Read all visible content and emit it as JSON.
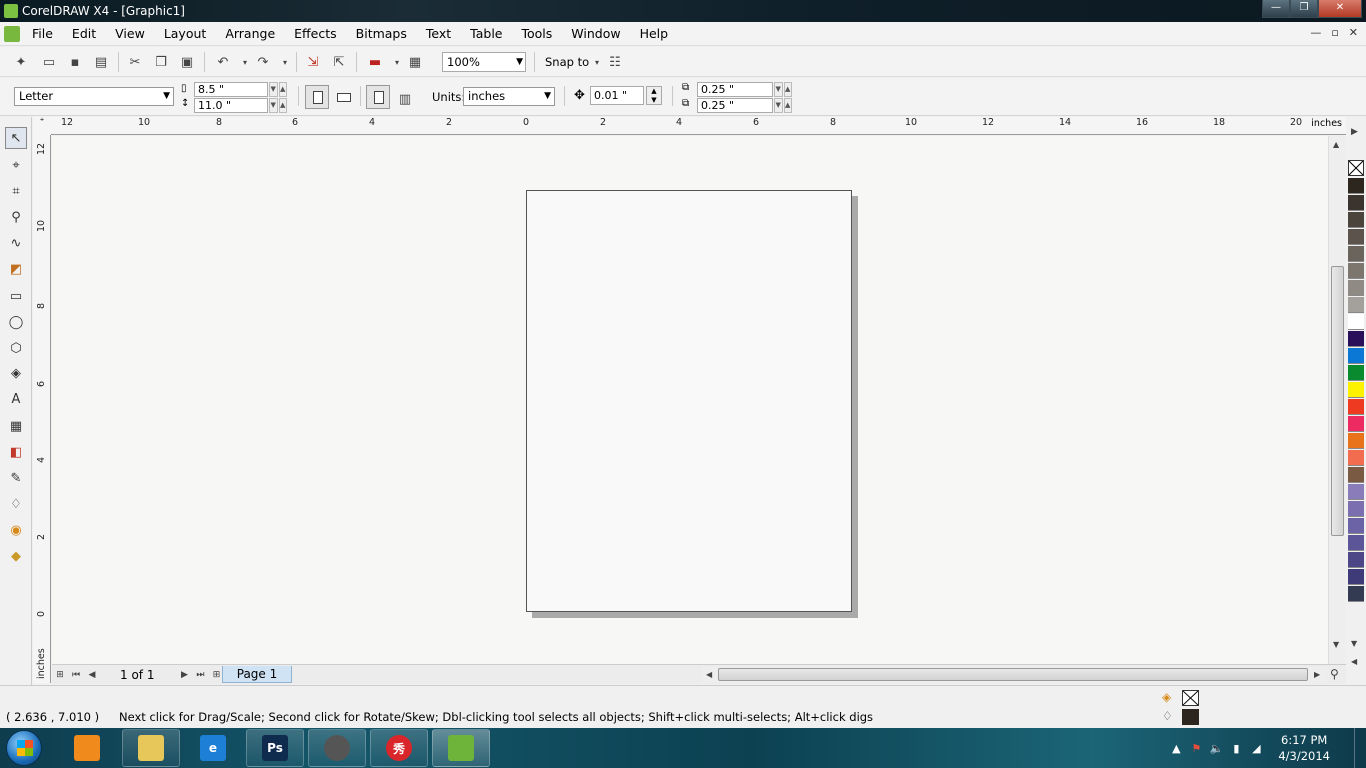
{
  "window": {
    "title": "CorelDRAW X4 - [Graphic1]",
    "controls": {
      "minimize": "—",
      "maximize": "❐",
      "close": "✕"
    }
  },
  "menu": {
    "items": [
      "File",
      "Edit",
      "View",
      "Layout",
      "Arrange",
      "Effects",
      "Bitmaps",
      "Text",
      "Table",
      "Tools",
      "Window",
      "Help"
    ],
    "mdi_controls": [
      "—",
      "▫",
      "✕"
    ]
  },
  "standard_toolbar": {
    "zoom_level": "100%",
    "snap_to_label": "Snap to"
  },
  "property_bar": {
    "paper_type": "Letter",
    "page_width": "8.5 \"",
    "page_height": "11.0 \"",
    "units_label": "Units:",
    "units_value": "inches",
    "nudge_distance": "0.01 \"",
    "duplicate_x": "0.25 \"",
    "duplicate_y": "0.25 \""
  },
  "ruler": {
    "units": "inches",
    "h_ticks": [
      "12",
      "10",
      "8",
      "6",
      "4",
      "2",
      "0",
      "2",
      "4",
      "6",
      "8",
      "10",
      "12",
      "14",
      "16",
      "18",
      "20"
    ],
    "v_ticks": [
      "12",
      "10",
      "8",
      "6",
      "4",
      "2",
      "0"
    ],
    "v_units": "inches"
  },
  "page_navigator": {
    "count": "1 of 1",
    "tab_label": "Page 1"
  },
  "palette": {
    "colors": [
      "#2d261f",
      "#3b342e",
      "#4b443d",
      "#5b534c",
      "#6b645d",
      "#7c766f",
      "#8f8a84",
      "#a4a09b",
      "#ffffff",
      "#2a0f5a",
      "#0a78d4",
      "#0a8a2e",
      "#fff200",
      "#ef3a22",
      "#ee2a62",
      "#e8731a",
      "#f26c4f",
      "#7a5a43",
      "#8a7cb8",
      "#7b6fb0",
      "#6c62a6",
      "#5c5597",
      "#4d4788",
      "#3f3a78",
      "#333b52"
    ]
  },
  "status": {
    "coordinates": "( 2.636 , 7.010  )",
    "hint": "Next click for Drag/Scale; Second click for Rotate/Skew; Dbl-clicking tool selects all objects; Shift+click multi-selects; Alt+click digs"
  },
  "taskbar": {
    "apps": [
      {
        "name": "media-player",
        "label": "",
        "color": "#f08a1c"
      },
      {
        "name": "file-explorer",
        "label": "",
        "color": "#e7c65a"
      },
      {
        "name": "internet-explorer",
        "label": "e",
        "color": "#1e7fd6"
      },
      {
        "name": "photoshop",
        "label": "Ps",
        "color": "#0f2c4e"
      },
      {
        "name": "chrome-like",
        "label": "",
        "color": "#555555"
      },
      {
        "name": "meitu",
        "label": "秀",
        "color": "#d8262b"
      },
      {
        "name": "coreldraw",
        "label": "",
        "color": "#6fb43a"
      }
    ],
    "clock_time": "6:17 PM",
    "clock_date": "4/3/2014"
  }
}
